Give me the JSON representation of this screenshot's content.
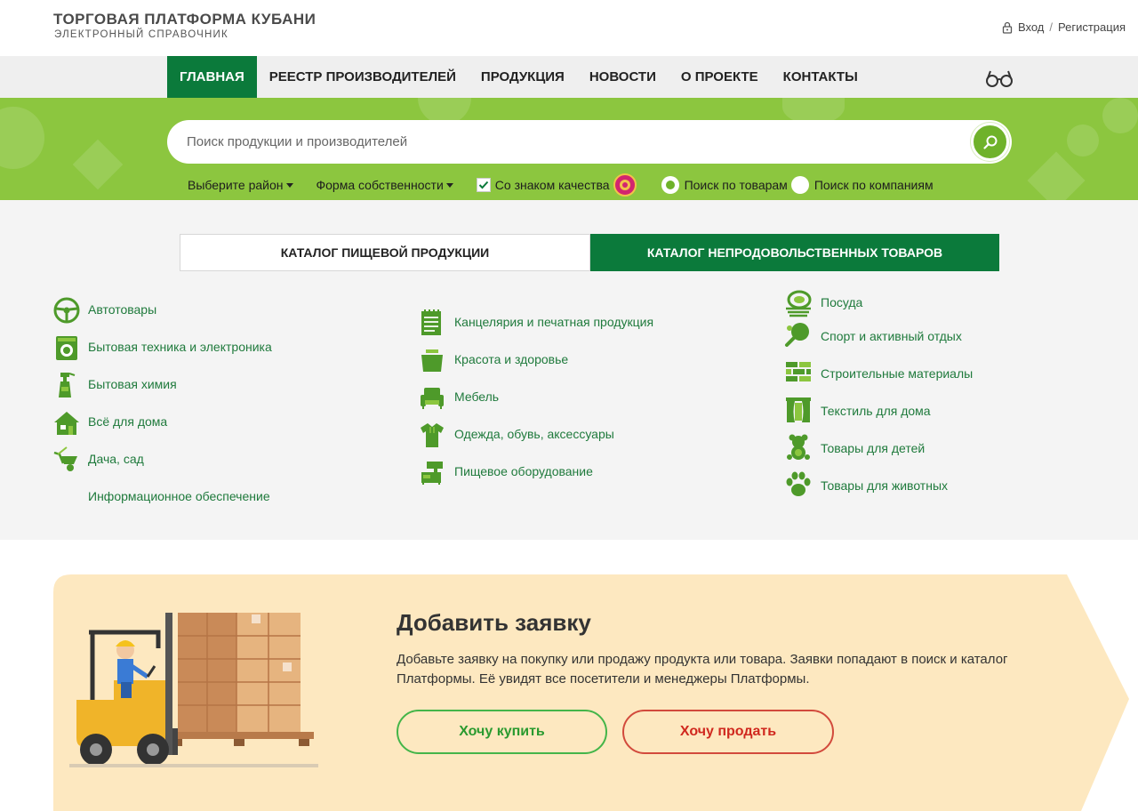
{
  "header": {
    "title": "ТОРГОВАЯ ПЛАТФОРМА КУБАНИ",
    "subtitle": "ЭЛЕКТРОННЫЙ СПРАВОЧНИК",
    "login": "Вход",
    "separator": "/",
    "register": "Регистрация"
  },
  "nav": {
    "items": [
      {
        "label": "ГЛАВНАЯ"
      },
      {
        "label": "РЕЕСТР ПРОИЗВОДИТЕЛЕЙ"
      },
      {
        "label": "ПРОДУКЦИЯ"
      },
      {
        "label": "НОВОСТИ"
      },
      {
        "label": "О ПРОЕКТЕ"
      },
      {
        "label": "КОНТАКТЫ"
      }
    ],
    "active_index": 0
  },
  "search": {
    "placeholder": "Поиск продукции и производителей",
    "value": "",
    "filters": {
      "district": "Выберите район",
      "ownership": "Форма собственности",
      "quality_label": "Со знаком качества",
      "quality_checked": true,
      "radio_products": "Поиск по товарам",
      "radio_companies": "Поиск по компаниям",
      "radio_selected": "products"
    }
  },
  "catalog": {
    "tabs": [
      {
        "label": "КАТАЛОГ ПИЩЕВОЙ ПРОДУКЦИИ",
        "active": false
      },
      {
        "label": "КАТАЛОГ НЕПРОДОВОЛЬСТВЕННЫХ ТОВАРОВ",
        "active": true
      }
    ],
    "columns": [
      [
        {
          "label": "Автотовары",
          "icon": "steering-wheel-icon"
        },
        {
          "label": "Бытовая техника и электроника",
          "icon": "washing-machine-icon"
        },
        {
          "label": "Бытовая химия",
          "icon": "spray-bottle-icon"
        },
        {
          "label": "Всё для дома",
          "icon": "house-icon"
        },
        {
          "label": "Дача, сад",
          "icon": "wheelbarrow-icon"
        },
        {
          "label": "Информационное обеспечение",
          "icon": ""
        }
      ],
      [
        {
          "label": "Канцелярия и печатная продукция",
          "icon": "notepad-icon"
        },
        {
          "label": "Красота и здоровье",
          "icon": "cosmetics-jar-icon"
        },
        {
          "label": "Мебель",
          "icon": "armchair-icon"
        },
        {
          "label": "Одежда, обувь, аксессуары",
          "icon": "shirt-icon"
        },
        {
          "label": "Пищевое оборудование",
          "icon": "food-machine-icon"
        }
      ],
      [
        {
          "label": "Посуда",
          "icon": "plates-icon"
        },
        {
          "label": "Спорт и активный отдых",
          "icon": "ping-pong-icon"
        },
        {
          "label": "Строительные материалы",
          "icon": "bricks-icon"
        },
        {
          "label": "Текстиль для дома",
          "icon": "curtains-icon"
        },
        {
          "label": "Товары для детей",
          "icon": "teddy-bear-icon"
        },
        {
          "label": "Товары для животных",
          "icon": "paw-icon"
        }
      ]
    ]
  },
  "request": {
    "title": "Добавить заявку",
    "text": "Добавьте заявку на покупку или продажу продукта или товара. Заявки попадают в поиск и каталог Платформы. Её увидят все посетители и менеджеры Платформы.",
    "buy_label": "Хочу купить",
    "sell_label": "Хочу продать"
  },
  "colors": {
    "primary_green": "#0b7a3b",
    "light_green": "#8cc63f",
    "accent_green": "#6fb22a",
    "link_green": "#1f7a3c",
    "card_bg": "#fde8c0",
    "buy": "#44b549",
    "sell": "#d24a3c"
  }
}
